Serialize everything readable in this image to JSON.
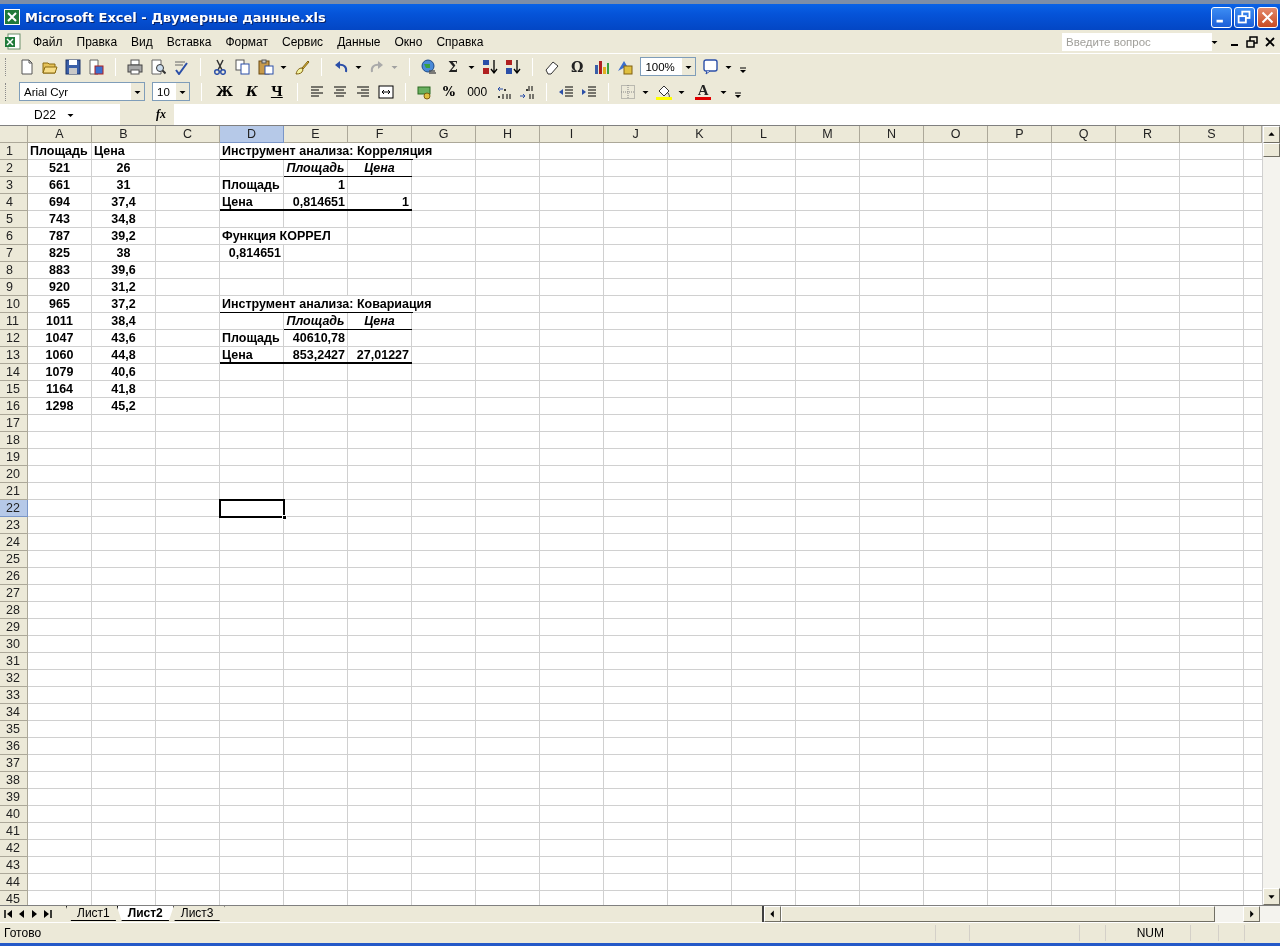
{
  "window": {
    "title": "Microsoft Excel - Двумерные данные.xls"
  },
  "menu": [
    "Файл",
    "Правка",
    "Вид",
    "Вставка",
    "Формат",
    "Сервис",
    "Данные",
    "Окно",
    "Справка"
  ],
  "help_box": {
    "placeholder": "Введите вопрос"
  },
  "standard_toolbar": {
    "sum_label": "Σ",
    "symbol_label": "Ω",
    "zoom": "100%"
  },
  "formatting_toolbar": {
    "font": "Arial Cyr",
    "size": "10",
    "bold_label": "Ж",
    "italic_label": "К",
    "underline_label": "Ч",
    "percent_label": "%",
    "thousands_label": "000",
    "font_color_label": "A"
  },
  "formula_bar": {
    "name_box": "D22",
    "fx_label": "fx"
  },
  "sheet": {
    "columns": [
      {
        "label": "A",
        "selected": false
      },
      {
        "label": "B",
        "selected": false
      },
      {
        "label": "C",
        "selected": false
      },
      {
        "label": "D",
        "selected": true
      },
      {
        "label": "E",
        "selected": false
      },
      {
        "label": "F",
        "selected": false
      },
      {
        "label": "G",
        "selected": false
      },
      {
        "label": "H",
        "selected": false
      },
      {
        "label": "I",
        "selected": false
      },
      {
        "label": "J",
        "selected": false
      },
      {
        "label": "K",
        "selected": false
      },
      {
        "label": "L",
        "selected": false
      },
      {
        "label": "M",
        "selected": false
      },
      {
        "label": "N",
        "selected": false
      },
      {
        "label": "O",
        "selected": false
      },
      {
        "label": "P",
        "selected": false
      },
      {
        "label": "Q",
        "selected": false
      },
      {
        "label": "R",
        "selected": false
      },
      {
        "label": "S",
        "selected": false
      }
    ],
    "rows": [
      {
        "number": "1",
        "selected": false,
        "cells": [
          {
            "kind": "label",
            "text": "Площадь",
            "italic": false,
            "rule": false
          },
          {
            "kind": "label",
            "text": "Цена",
            "italic": false,
            "rule": false
          },
          {
            "kind": "blank",
            "rule": false
          },
          {
            "kind": "label",
            "text": "Инструмент анализа: Корреляция",
            "italic": false,
            "rule": true,
            "thick": false
          },
          {
            "kind": "blank",
            "rule": true,
            "thick": false
          },
          {
            "kind": "blank",
            "rule": true,
            "thick": false
          }
        ]
      },
      {
        "number": "2",
        "selected": false,
        "cells": [
          {
            "kind": "centered",
            "text": "521",
            "italic": false,
            "rule": false
          },
          {
            "kind": "centered",
            "text": "26",
            "italic": false,
            "rule": false
          },
          {
            "kind": "blank",
            "rule": false
          },
          {
            "kind": "blank",
            "rule": false
          },
          {
            "kind": "centered",
            "text": "Площадь",
            "italic": true,
            "rule": true,
            "thick": false
          },
          {
            "kind": "centered",
            "text": "Цена",
            "italic": true,
            "rule": true,
            "thick": false
          }
        ]
      },
      {
        "number": "3",
        "selected": false,
        "cells": [
          {
            "kind": "centered",
            "text": "661",
            "italic": false,
            "rule": false
          },
          {
            "kind": "centered",
            "text": "31",
            "italic": false,
            "rule": false
          },
          {
            "kind": "blank",
            "rule": false
          },
          {
            "kind": "label",
            "text": "Площадь",
            "italic": false,
            "rule": false
          },
          {
            "kind": "number",
            "text": "1",
            "italic": false,
            "rule": false
          }
        ]
      },
      {
        "number": "4",
        "selected": false,
        "cells": [
          {
            "kind": "centered",
            "text": "694",
            "italic": false,
            "rule": false
          },
          {
            "kind": "centered",
            "text": "37,4",
            "italic": false,
            "rule": false
          },
          {
            "kind": "blank",
            "rule": false
          },
          {
            "kind": "label",
            "text": "Цена",
            "italic": false,
            "rule": true,
            "thick": true
          },
          {
            "kind": "number",
            "text": "0,814651",
            "italic": false,
            "rule": true,
            "thick": true
          },
          {
            "kind": "number",
            "text": "1",
            "italic": false,
            "rule": true,
            "thick": true
          }
        ]
      },
      {
        "number": "5",
        "selected": false,
        "cells": [
          {
            "kind": "centered",
            "text": "743",
            "italic": false,
            "rule": false
          },
          {
            "kind": "centered",
            "text": "34,8",
            "italic": false,
            "rule": false
          }
        ]
      },
      {
        "number": "6",
        "selected": false,
        "cells": [
          {
            "kind": "centered",
            "text": "787",
            "italic": false,
            "rule": false
          },
          {
            "kind": "centered",
            "text": "39,2",
            "italic": false,
            "rule": false
          },
          {
            "kind": "blank",
            "rule": false
          },
          {
            "kind": "label",
            "text": "Функция КОРРЕЛ",
            "italic": false,
            "rule": false
          }
        ]
      },
      {
        "number": "7",
        "selected": false,
        "cells": [
          {
            "kind": "centered",
            "text": "825",
            "italic": false,
            "rule": false
          },
          {
            "kind": "centered",
            "text": "38",
            "italic": false,
            "rule": false
          },
          {
            "kind": "blank",
            "rule": false
          },
          {
            "kind": "number",
            "text": "0,814651",
            "italic": false,
            "rule": false
          }
        ]
      },
      {
        "number": "8",
        "selected": false,
        "cells": [
          {
            "kind": "centered",
            "text": "883",
            "italic": false,
            "rule": false
          },
          {
            "kind": "centered",
            "text": "39,6",
            "italic": false,
            "rule": false
          }
        ]
      },
      {
        "number": "9",
        "selected": false,
        "cells": [
          {
            "kind": "centered",
            "text": "920",
            "italic": false,
            "rule": false
          },
          {
            "kind": "centered",
            "text": "31,2",
            "italic": false,
            "rule": false
          }
        ]
      },
      {
        "number": "10",
        "selected": false,
        "cells": [
          {
            "kind": "centered",
            "text": "965",
            "italic": false,
            "rule": false
          },
          {
            "kind": "centered",
            "text": "37,2",
            "italic": false,
            "rule": false
          },
          {
            "kind": "blank",
            "rule": false
          },
          {
            "kind": "label",
            "text": "Инструмент анализа: Ковариация",
            "italic": false,
            "rule": true,
            "thick": false
          },
          {
            "kind": "blank",
            "rule": true,
            "thick": false
          },
          {
            "kind": "blank",
            "rule": true,
            "thick": false
          }
        ]
      },
      {
        "number": "11",
        "selected": false,
        "cells": [
          {
            "kind": "centered",
            "text": "1011",
            "italic": false,
            "rule": false
          },
          {
            "kind": "centered",
            "text": "38,4",
            "italic": false,
            "rule": false
          },
          {
            "kind": "blank",
            "rule": false
          },
          {
            "kind": "blank",
            "rule": false
          },
          {
            "kind": "centered",
            "text": "Площадь",
            "italic": true,
            "rule": true,
            "thick": false
          },
          {
            "kind": "centered",
            "text": "Цена",
            "italic": true,
            "rule": true,
            "thick": false
          }
        ]
      },
      {
        "number": "12",
        "selected": false,
        "cells": [
          {
            "kind": "centered",
            "text": "1047",
            "italic": false,
            "rule": false
          },
          {
            "kind": "centered",
            "text": "43,6",
            "italic": false,
            "rule": false
          },
          {
            "kind": "blank",
            "rule": false
          },
          {
            "kind": "label",
            "text": "Площадь",
            "italic": false,
            "rule": false
          },
          {
            "kind": "number",
            "text": "40610,78",
            "italic": false,
            "rule": false
          }
        ]
      },
      {
        "number": "13",
        "selected": false,
        "cells": [
          {
            "kind": "centered",
            "text": "1060",
            "italic": false,
            "rule": false
          },
          {
            "kind": "centered",
            "text": "44,8",
            "italic": false,
            "rule": false
          },
          {
            "kind": "blank",
            "rule": false
          },
          {
            "kind": "label",
            "text": "Цена",
            "italic": false,
            "rule": true,
            "thick": true
          },
          {
            "kind": "number",
            "text": "853,2427",
            "italic": false,
            "rule": true,
            "thick": true
          },
          {
            "kind": "number",
            "text": "27,01227",
            "italic": false,
            "rule": true,
            "thick": true
          }
        ]
      },
      {
        "number": "14",
        "selected": false,
        "cells": [
          {
            "kind": "centered",
            "text": "1079",
            "italic": false,
            "rule": false
          },
          {
            "kind": "centered",
            "text": "40,6",
            "italic": false,
            "rule": false
          }
        ]
      },
      {
        "number": "15",
        "selected": false,
        "cells": [
          {
            "kind": "centered",
            "text": "1164",
            "italic": false,
            "rule": false
          },
          {
            "kind": "centered",
            "text": "41,8",
            "italic": false,
            "rule": false
          }
        ]
      },
      {
        "number": "16",
        "selected": false,
        "cells": [
          {
            "kind": "centered",
            "text": "1298",
            "italic": false,
            "rule": false
          },
          {
            "kind": "centered",
            "text": "45,2",
            "italic": false,
            "rule": false
          }
        ]
      },
      {
        "number": "17",
        "selected": false
      },
      {
        "number": "18",
        "selected": false
      },
      {
        "number": "19",
        "selected": false
      },
      {
        "number": "20",
        "selected": false
      },
      {
        "number": "21",
        "selected": false
      },
      {
        "number": "22",
        "selected": true
      },
      {
        "number": "23",
        "selected": false
      },
      {
        "number": "24",
        "selected": false
      },
      {
        "number": "25",
        "selected": false
      },
      {
        "number": "26",
        "selected": false
      },
      {
        "number": "27",
        "selected": false
      },
      {
        "number": "28",
        "selected": false
      },
      {
        "number": "29",
        "selected": false
      },
      {
        "number": "30",
        "selected": false
      },
      {
        "number": "31",
        "selected": false
      },
      {
        "number": "32",
        "selected": false
      },
      {
        "number": "33",
        "selected": false
      },
      {
        "number": "34",
        "selected": false
      },
      {
        "number": "35",
        "selected": false
      },
      {
        "number": "36",
        "selected": false
      },
      {
        "number": "37",
        "selected": false
      },
      {
        "number": "38",
        "selected": false
      },
      {
        "number": "39",
        "selected": false
      },
      {
        "number": "40",
        "selected": false
      },
      {
        "number": "41",
        "selected": false
      },
      {
        "number": "42",
        "selected": false
      },
      {
        "number": "43",
        "selected": false
      },
      {
        "number": "44",
        "selected": false
      },
      {
        "number": "45",
        "selected": false
      }
    ]
  },
  "sheet_tabs": [
    {
      "label": "Лист1",
      "selected": false
    },
    {
      "label": "Лист2",
      "selected": true
    },
    {
      "label": "Лист3",
      "selected": false
    }
  ],
  "status_bar": {
    "text": "Готово",
    "indicator": "NUM"
  }
}
